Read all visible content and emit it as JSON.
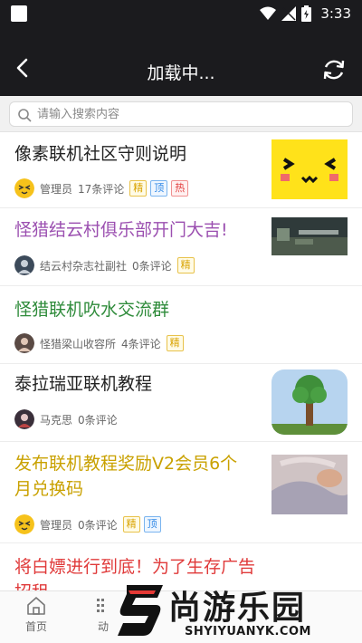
{
  "statusbar": {
    "time": "3:33"
  },
  "header": {
    "title": "加载中..."
  },
  "search": {
    "placeholder": "请输入搜索内容"
  },
  "posts": [
    {
      "title": "像素联机社区守则说明",
      "title_color": "#222222",
      "author": "管理员",
      "comments": "17条评论",
      "tags": [
        "精",
        "顶",
        "热"
      ],
      "thumb": "pixel-smiley"
    },
    {
      "title": "怪猎结云村俱乐部开门大吉!",
      "title_color": "#9b4fb0",
      "author": "结云村杂志社副社",
      "comments": "0条评论",
      "tags": [
        "精"
      ],
      "thumb": "dark-screenshot"
    },
    {
      "title": "怪猎联机吹水交流群",
      "title_color": "#2e8b3a",
      "author": "怪猎梁山收容所",
      "comments": "4条评论",
      "tags": [
        "精"
      ],
      "thumb": "beige-strip"
    },
    {
      "title": "泰拉瑞亚联机教程",
      "title_color": "#222222",
      "author": "马克思",
      "comments": "0条评论",
      "tags": [],
      "thumb": "terraria-tree"
    },
    {
      "title": "发布联机教程奖励V2会员6个月兑换码",
      "title_color": "#c9a100",
      "author": "管理员",
      "comments": "0条评论",
      "tags": [
        "精",
        "顶"
      ],
      "thumb": "cat-photo"
    },
    {
      "title": "将白嫖进行到底！为了生存广告招租",
      "title_color": "#e03a3a"
    }
  ],
  "bottom_nav": [
    {
      "label": "首页",
      "icon": "home-icon"
    },
    {
      "label": "动",
      "icon": "feed-icon"
    }
  ],
  "watermark": {
    "cn": "尚游乐园",
    "en": "SHYIYUANYK.COM"
  }
}
